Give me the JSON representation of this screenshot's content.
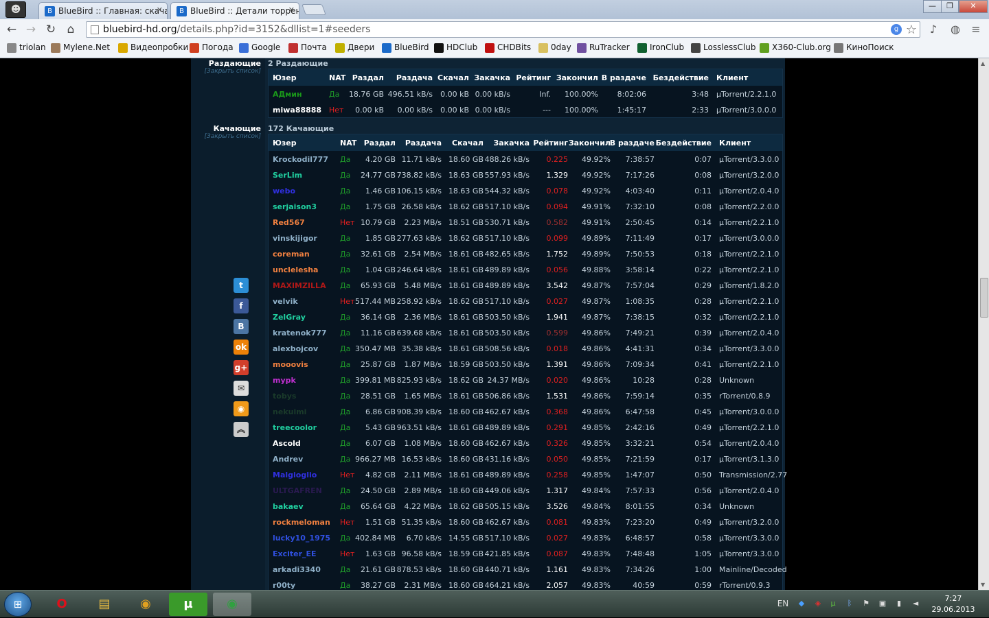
{
  "browser": {
    "avatar": "☻",
    "tabs": [
      {
        "title": "BlueBird :: Главная: скача",
        "active": false
      },
      {
        "title": "BlueBird :: Детали торрен",
        "active": true
      }
    ],
    "url_host": "bluebird-hd.org",
    "url_path": "/details.php?id=3152&dllist=1#seeders",
    "window_buttons": [
      "—",
      "❐",
      "✕"
    ],
    "bookmarks": [
      {
        "label": "triolan",
        "color": "#888888"
      },
      {
        "label": "Mylene.Net",
        "color": "#9b7a5a"
      },
      {
        "label": "Видеопробки",
        "color": "#d9a800"
      },
      {
        "label": "Погода",
        "color": "#d04020"
      },
      {
        "label": "Google",
        "color": "#3a6fd8"
      },
      {
        "label": "Почта",
        "color": "#c03030"
      },
      {
        "label": "Двери",
        "color": "#c0b000"
      },
      {
        "label": "BlueBird",
        "color": "#1b6ac9"
      },
      {
        "label": "HDClub",
        "color": "#111111"
      },
      {
        "label": "CHDBits",
        "color": "#c01010"
      },
      {
        "label": "0day",
        "color": "#d8c060"
      },
      {
        "label": "RuTracker",
        "color": "#7050a0"
      },
      {
        "label": "IronClub",
        "color": "#106030"
      },
      {
        "label": "LosslessClub",
        "color": "#444444"
      },
      {
        "label": "X360-Club.org",
        "color": "#60a020"
      },
      {
        "label": "КиноПоиск",
        "color": "#777777"
      }
    ]
  },
  "seeders": {
    "label": "Раздающие",
    "close_link": "[Закрыть список]",
    "count": "2 Раздающие",
    "headers": [
      "Юзер",
      "NAT",
      "Раздал",
      "Раздача",
      "Скачал",
      "Закачка",
      "Рейтинг",
      "Закончил",
      "В раздаче",
      "Бездействие",
      "Клиент"
    ],
    "rows": [
      {
        "user": "АДмин",
        "ucolor": "#1a9a1a",
        "nat": "Да",
        "up": "18.76 GB",
        "upr": "496.51 kB/s",
        "down": "0.00 kB",
        "downr": "0.00 kB/s",
        "ratio": "Inf.",
        "rcolor": "#c5d2dc",
        "done": "100.00%",
        "conn": "8:02:06",
        "idle": "3:48",
        "client": "µTorrent/2.2.1.0"
      },
      {
        "user": "miwa88888",
        "ucolor": "#ffffff",
        "nat": "Нет",
        "up": "0.00 kB",
        "upr": "0.00 kB/s",
        "down": "0.00 kB",
        "downr": "0.00 kB/s",
        "ratio": "---",
        "rcolor": "#c5d2dc",
        "done": "100.00%",
        "conn": "1:45:17",
        "idle": "2:33",
        "client": "µTorrent/3.0.0.0"
      }
    ]
  },
  "leechers": {
    "label": "Качающие",
    "close_link": "[Закрыть список]",
    "count": "172 Качающие",
    "headers": [
      "Юзер",
      "NAT",
      "Раздал",
      "Раздача",
      "Скачал",
      "Закачка",
      "Рейтинг",
      "Закончил",
      "В раздаче",
      "Бездействие",
      "Клиент"
    ],
    "rows": [
      {
        "user": "Krockodil777",
        "ucolor": "#8fb0c8",
        "nat": "Да",
        "up": "4.20 GB",
        "upr": "11.71 kB/s",
        "down": "18.60 GB",
        "downr": "488.26 kB/s",
        "ratio": "0.225",
        "rcolor": "#e02020",
        "done": "49.92%",
        "conn": "7:38:57",
        "idle": "0:07",
        "client": "µTorrent/3.3.0.0"
      },
      {
        "user": "SerLim",
        "ucolor": "#20d0a0",
        "nat": "Да",
        "up": "24.77 GB",
        "upr": "738.82 kB/s",
        "down": "18.63 GB",
        "downr": "557.93 kB/s",
        "ratio": "1.329",
        "rcolor": "#ffffff",
        "done": "49.92%",
        "conn": "7:17:26",
        "idle": "0:08",
        "client": "µTorrent/3.2.0.0"
      },
      {
        "user": "webo",
        "ucolor": "#3030e0",
        "nat": "Да",
        "up": "1.46 GB",
        "upr": "106.15 kB/s",
        "down": "18.63 GB",
        "downr": "544.32 kB/s",
        "ratio": "0.078",
        "rcolor": "#e02020",
        "done": "49.92%",
        "conn": "4:03:40",
        "idle": "0:11",
        "client": "µTorrent/2.0.4.0"
      },
      {
        "user": "serjaison3",
        "ucolor": "#20d0a0",
        "nat": "Да",
        "up": "1.75 GB",
        "upr": "26.58 kB/s",
        "down": "18.62 GB",
        "downr": "517.10 kB/s",
        "ratio": "0.094",
        "rcolor": "#e02020",
        "done": "49.91%",
        "conn": "7:32:10",
        "idle": "0:08",
        "client": "µTorrent/2.2.0.0"
      },
      {
        "user": "Red567",
        "ucolor": "#f08040",
        "nat": "Нет",
        "up": "10.79 GB",
        "upr": "2.23 MB/s",
        "down": "18.51 GB",
        "downr": "530.71 kB/s",
        "ratio": "0.582",
        "rcolor": "#a03030",
        "done": "49.91%",
        "conn": "2:50:45",
        "idle": "0:14",
        "client": "µTorrent/2.2.1.0"
      },
      {
        "user": "vinskijigor",
        "ucolor": "#8fb0c8",
        "nat": "Да",
        "up": "1.85 GB",
        "upr": "277.63 kB/s",
        "down": "18.62 GB",
        "downr": "517.10 kB/s",
        "ratio": "0.099",
        "rcolor": "#e02020",
        "done": "49.89%",
        "conn": "7:11:49",
        "idle": "0:17",
        "client": "µTorrent/3.0.0.0"
      },
      {
        "user": "coreman",
        "ucolor": "#f08040",
        "nat": "Да",
        "up": "32.61 GB",
        "upr": "2.54 MB/s",
        "down": "18.61 GB",
        "downr": "482.65 kB/s",
        "ratio": "1.752",
        "rcolor": "#ffffff",
        "done": "49.89%",
        "conn": "7:50:53",
        "idle": "0:18",
        "client": "µTorrent/2.2.1.0"
      },
      {
        "user": "unclelesha",
        "ucolor": "#f08040",
        "nat": "Да",
        "up": "1.04 GB",
        "upr": "246.64 kB/s",
        "down": "18.61 GB",
        "downr": "489.89 kB/s",
        "ratio": "0.056",
        "rcolor": "#e02020",
        "done": "49.88%",
        "conn": "3:58:14",
        "idle": "0:22",
        "client": "µTorrent/2.2.1.0"
      },
      {
        "user": "MAXIMZILLA",
        "ucolor": "#b01818",
        "nat": "Да",
        "up": "65.93 GB",
        "upr": "5.48 MB/s",
        "down": "18.61 GB",
        "downr": "489.89 kB/s",
        "ratio": "3.542",
        "rcolor": "#ffffff",
        "done": "49.87%",
        "conn": "7:57:04",
        "idle": "0:29",
        "client": "µTorrent/1.8.2.0"
      },
      {
        "user": "velvik",
        "ucolor": "#8fb0c8",
        "nat": "Нет",
        "up": "517.44 MB",
        "upr": "258.92 kB/s",
        "down": "18.62 GB",
        "downr": "517.10 kB/s",
        "ratio": "0.027",
        "rcolor": "#e02020",
        "done": "49.87%",
        "conn": "1:08:35",
        "idle": "0:28",
        "client": "µTorrent/2.2.1.0"
      },
      {
        "user": "ZelGray",
        "ucolor": "#20d0a0",
        "nat": "Да",
        "up": "36.14 GB",
        "upr": "2.36 MB/s",
        "down": "18.61 GB",
        "downr": "503.50 kB/s",
        "ratio": "1.941",
        "rcolor": "#ffffff",
        "done": "49.87%",
        "conn": "7:38:15",
        "idle": "0:32",
        "client": "µTorrent/2.2.1.0"
      },
      {
        "user": "kratenok777",
        "ucolor": "#8fb0c8",
        "nat": "Да",
        "up": "11.16 GB",
        "upr": "639.68 kB/s",
        "down": "18.61 GB",
        "downr": "503.50 kB/s",
        "ratio": "0.599",
        "rcolor": "#a03030",
        "done": "49.86%",
        "conn": "7:49:21",
        "idle": "0:39",
        "client": "µTorrent/2.0.4.0"
      },
      {
        "user": "alexbojcov",
        "ucolor": "#8fb0c8",
        "nat": "Да",
        "up": "350.47 MB",
        "upr": "35.38 kB/s",
        "down": "18.61 GB",
        "downr": "508.56 kB/s",
        "ratio": "0.018",
        "rcolor": "#e02020",
        "done": "49.86%",
        "conn": "4:41:31",
        "idle": "0:34",
        "client": "µTorrent/3.3.0.0"
      },
      {
        "user": "mooovis",
        "ucolor": "#f08040",
        "nat": "Да",
        "up": "25.87 GB",
        "upr": "1.87 MB/s",
        "down": "18.59 GB",
        "downr": "503.50 kB/s",
        "ratio": "1.391",
        "rcolor": "#ffffff",
        "done": "49.86%",
        "conn": "7:09:34",
        "idle": "0:41",
        "client": "µTorrent/2.2.1.0"
      },
      {
        "user": "mypk",
        "ucolor": "#c030d0",
        "nat": "Да",
        "up": "399.81 MB",
        "upr": "825.93 kB/s",
        "down": "18.62 GB",
        "downr": "24.37 MB/s",
        "ratio": "0.020",
        "rcolor": "#e02020",
        "done": "49.86%",
        "conn": "10:28",
        "idle": "0:28",
        "client": "Unknown"
      },
      {
        "user": "tobys",
        "ucolor": "#1a3a2a",
        "nat": "Да",
        "up": "28.51 GB",
        "upr": "1.65 MB/s",
        "down": "18.61 GB",
        "downr": "506.86 kB/s",
        "ratio": "1.531",
        "rcolor": "#ffffff",
        "done": "49.86%",
        "conn": "7:59:14",
        "idle": "0:35",
        "client": "rTorrent/0.8.9"
      },
      {
        "user": "nekuimi",
        "ucolor": "#1a3a2a",
        "nat": "Да",
        "up": "6.86 GB",
        "upr": "908.39 kB/s",
        "down": "18.60 GB",
        "downr": "462.67 kB/s",
        "ratio": "0.368",
        "rcolor": "#e02020",
        "done": "49.86%",
        "conn": "6:47:58",
        "idle": "0:45",
        "client": "µTorrent/3.0.0.0"
      },
      {
        "user": "treecoolor",
        "ucolor": "#20d0a0",
        "nat": "Да",
        "up": "5.43 GB",
        "upr": "963.51 kB/s",
        "down": "18.61 GB",
        "downr": "489.89 kB/s",
        "ratio": "0.291",
        "rcolor": "#e02020",
        "done": "49.85%",
        "conn": "2:42:16",
        "idle": "0:49",
        "client": "µTorrent/2.2.1.0"
      },
      {
        "user": "Ascold",
        "ucolor": "#ffffff",
        "nat": "Да",
        "up": "6.07 GB",
        "upr": "1.08 MB/s",
        "down": "18.60 GB",
        "downr": "462.67 kB/s",
        "ratio": "0.326",
        "rcolor": "#e02020",
        "done": "49.85%",
        "conn": "3:32:21",
        "idle": "0:54",
        "client": "µTorrent/2.0.4.0"
      },
      {
        "user": "Andrev",
        "ucolor": "#8fb0c8",
        "nat": "Да",
        "up": "966.27 MB",
        "upr": "16.53 kB/s",
        "down": "18.60 GB",
        "downr": "431.16 kB/s",
        "ratio": "0.050",
        "rcolor": "#e02020",
        "done": "49.85%",
        "conn": "7:21:59",
        "idle": "0:17",
        "client": "µTorrent/3.1.3.0"
      },
      {
        "user": "Malgioglio",
        "ucolor": "#3030e0",
        "nat": "Нет",
        "up": "4.82 GB",
        "upr": "2.11 MB/s",
        "down": "18.61 GB",
        "downr": "489.89 kB/s",
        "ratio": "0.258",
        "rcolor": "#e02020",
        "done": "49.85%",
        "conn": "1:47:07",
        "idle": "0:50",
        "client": "Transmission/2.77"
      },
      {
        "user": "ULTGAFREN",
        "ucolor": "#2a1a50",
        "nat": "Да",
        "up": "24.50 GB",
        "upr": "2.89 MB/s",
        "down": "18.60 GB",
        "downr": "449.06 kB/s",
        "ratio": "1.317",
        "rcolor": "#ffffff",
        "done": "49.84%",
        "conn": "7:57:33",
        "idle": "0:56",
        "client": "µTorrent/2.0.4.0"
      },
      {
        "user": "bakaev",
        "ucolor": "#20d0a0",
        "nat": "Да",
        "up": "65.64 GB",
        "upr": "4.22 MB/s",
        "down": "18.62 GB",
        "downr": "505.15 kB/s",
        "ratio": "3.526",
        "rcolor": "#ffffff",
        "done": "49.84%",
        "conn": "8:01:55",
        "idle": "0:34",
        "client": "Unknown"
      },
      {
        "user": "rockmeloman",
        "ucolor": "#f08040",
        "nat": "Нет",
        "up": "1.51 GB",
        "upr": "51.35 kB/s",
        "down": "18.60 GB",
        "downr": "462.67 kB/s",
        "ratio": "0.081",
        "rcolor": "#e02020",
        "done": "49.83%",
        "conn": "7:23:20",
        "idle": "0:49",
        "client": "µTorrent/3.2.0.0"
      },
      {
        "user": "lucky10_1975",
        "ucolor": "#3050e0",
        "nat": "Да",
        "up": "402.84 MB",
        "upr": "6.70 kB/s",
        "down": "14.55 GB",
        "downr": "517.10 kB/s",
        "ratio": "0.027",
        "rcolor": "#e02020",
        "done": "49.83%",
        "conn": "6:48:57",
        "idle": "0:58",
        "client": "µTorrent/3.3.0.0"
      },
      {
        "user": "Exciter_EE",
        "ucolor": "#3050e0",
        "nat": "Нет",
        "up": "1.63 GB",
        "upr": "96.58 kB/s",
        "down": "18.59 GB",
        "downr": "421.85 kB/s",
        "ratio": "0.087",
        "rcolor": "#e02020",
        "done": "49.83%",
        "conn": "7:48:48",
        "idle": "1:05",
        "client": "µTorrent/3.3.0.0"
      },
      {
        "user": "arkadi3340",
        "ucolor": "#8fb0c8",
        "nat": "Да",
        "up": "21.61 GB",
        "upr": "878.53 kB/s",
        "down": "18.60 GB",
        "downr": "440.71 kB/s",
        "ratio": "1.161",
        "rcolor": "#ffffff",
        "done": "49.83%",
        "conn": "7:34:26",
        "idle": "1:00",
        "client": "Mainline/Decoded"
      },
      {
        "user": "r00ty",
        "ucolor": "#8fb0c8",
        "nat": "Да",
        "up": "38.27 GB",
        "upr": "2.31 MB/s",
        "down": "18.60 GB",
        "downr": "464.21 kB/s",
        "ratio": "2.057",
        "rcolor": "#ffffff",
        "done": "49.83%",
        "conn": "40:59",
        "idle": "0:59",
        "client": "rTorrent/0.9.3"
      }
    ]
  },
  "share_icons": [
    {
      "name": "twitter-icon",
      "glyph": "t",
      "color": "#2c8ed6"
    },
    {
      "name": "facebook-icon",
      "glyph": "f",
      "color": "#3b5998"
    },
    {
      "name": "vkontakte-icon",
      "glyph": "B",
      "color": "#4c75a3"
    },
    {
      "name": "odnoklassniki-icon",
      "glyph": "ok",
      "color": "#ee8208"
    },
    {
      "name": "googleplus-icon",
      "glyph": "g+",
      "color": "#d23e2b"
    },
    {
      "name": "email-icon",
      "glyph": "✉",
      "color": "#dddddd"
    },
    {
      "name": "rss-icon",
      "glyph": "◉",
      "color": "#f09a1a"
    },
    {
      "name": "scroll-top-icon",
      "glyph": "︽",
      "color": "#cccccc"
    }
  ],
  "taskbar": {
    "apps": [
      {
        "name": "opera-app",
        "glyph": "O",
        "color": "#e0101a",
        "bg": "transparent"
      },
      {
        "name": "explorer-app",
        "glyph": "▤",
        "color": "#f0c040",
        "bg": "transparent"
      },
      {
        "name": "chrome-app",
        "glyph": "◉",
        "color": "#e0a020",
        "bg": "transparent"
      },
      {
        "name": "utorrent-app",
        "glyph": "µ",
        "color": "#ffffff",
        "bg": "#3a9a2a"
      },
      {
        "name": "chrome-active-app",
        "glyph": "◉",
        "color": "#30a040",
        "bg": "rgba(255,255,255,0.25)"
      }
    ],
    "lang": "EN",
    "time": "7:27",
    "date": "29.06.2013"
  }
}
